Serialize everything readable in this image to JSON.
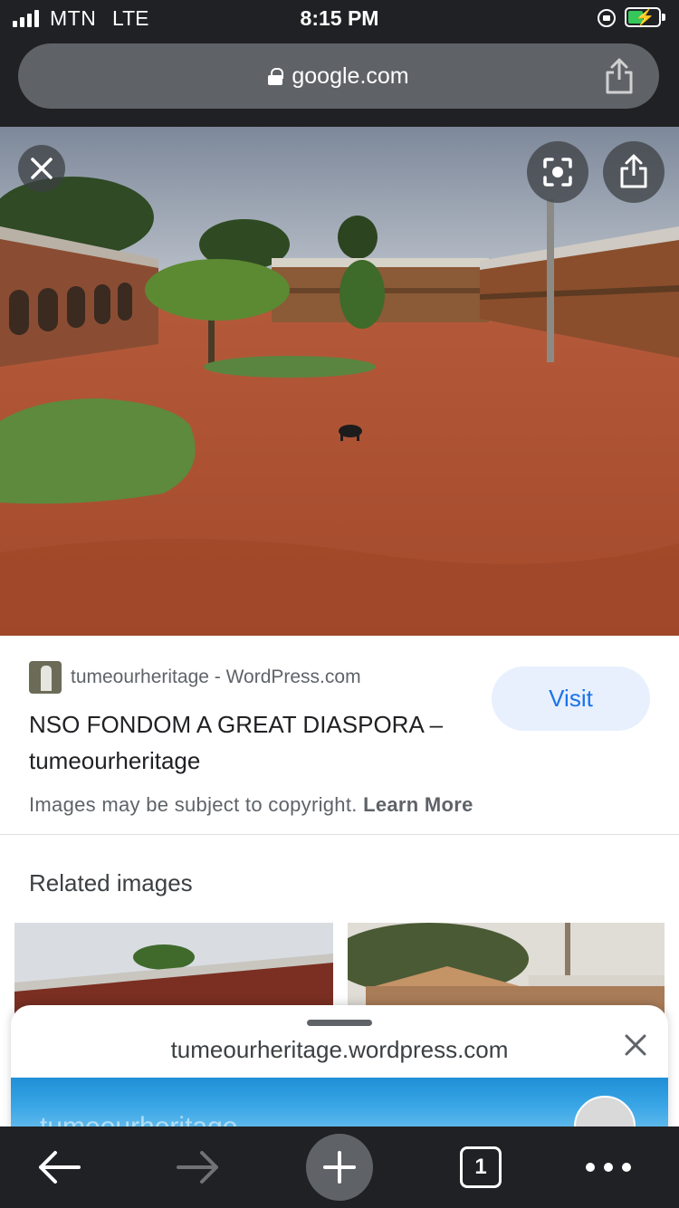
{
  "status_bar": {
    "carrier": "MTN",
    "network": "LTE",
    "time": "8:15 PM"
  },
  "url_bar": {
    "domain": "google.com"
  },
  "image_result": {
    "source": "tumeourheritage - WordPress.com",
    "title": "NSO FONDOM A GREAT DIASPORA – tumeourheritage",
    "visit_label": "Visit",
    "copyright_text": "Images may be subject to copyright.",
    "learn_more_label": "Learn More"
  },
  "related": {
    "heading": "Related images"
  },
  "bottom_sheet": {
    "site": "tumeourheritage.wordpress.com",
    "preview_text": "tumeourheritage"
  },
  "toolbar": {
    "tab_count": "1"
  },
  "colors": {
    "chrome_bg": "#202124",
    "url_bar_bg": "#5f6368",
    "visit_bg": "#e8f0fe",
    "visit_text": "#1a73e8",
    "battery_green": "#34c759"
  },
  "icons": [
    "signal-icon",
    "lock-rotation-icon",
    "battery-charging-icon",
    "padlock-icon",
    "share-icon",
    "close-icon",
    "lens-icon",
    "back-arrow-icon",
    "forward-arrow-icon",
    "plus-icon",
    "tabs-icon",
    "more-icon"
  ]
}
